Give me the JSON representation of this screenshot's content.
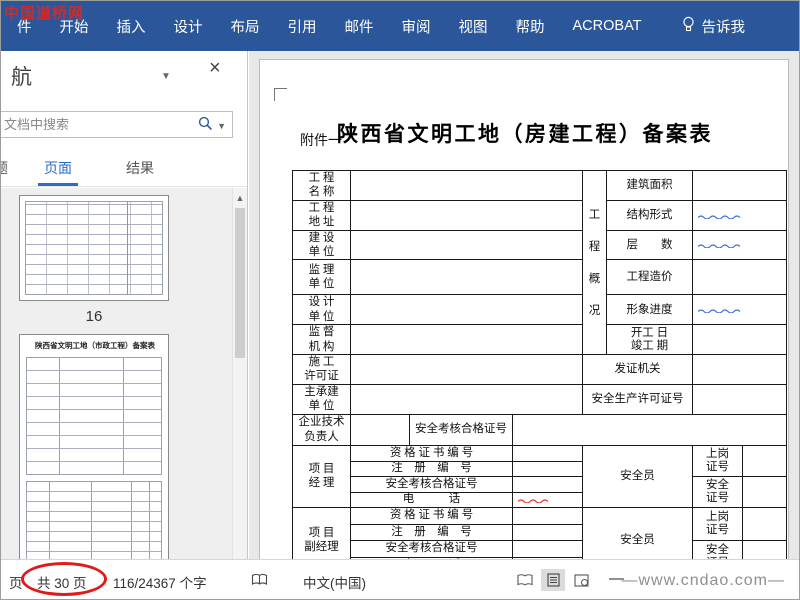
{
  "colors": {
    "ribbon": "#2b579a",
    "accent": "#2b6cc4",
    "annotation_red": "#e01b1b",
    "grammar_squiggle_blue": "#3b6fd4",
    "spelling_squiggle_red": "#e03131"
  },
  "icons": {
    "close": "×",
    "caret_down": "▼",
    "scroll_up": "▲",
    "minus": "—"
  },
  "watermarks": {
    "top_left": "中国道桥网",
    "bottom_right": "—www.cndao.com—"
  },
  "ribbon": {
    "tabs": [
      "件",
      "开始",
      "插入",
      "设计",
      "布局",
      "引用",
      "邮件",
      "审阅",
      "视图",
      "帮助",
      "ACROBAT"
    ],
    "tell_me": "告诉我"
  },
  "nav_pane": {
    "title": "航",
    "search_placeholder": "文档中搜索",
    "tabs": [
      "题",
      "页面",
      "结果"
    ],
    "active_tab": "页面",
    "thumbnail_page_number": "16",
    "thumbnail2_title": "陕西省文明工地（市政工程）备案表"
  },
  "document": {
    "attachment_label": "附件一",
    "title": "陕西省文明工地（房建工程）备案表",
    "table": {
      "left_rows": [
        "工 程\n名 称",
        "工 程\n地 址",
        "建 设\n单 位",
        "监 理\n单 位",
        "设 计\n单 位",
        "监 督\n机 构",
        "施 工\n许可证",
        "主承建\n单 位"
      ],
      "overview_title": "工\n程\n概\n况",
      "overview_items": [
        "建筑面积",
        "结构形式",
        "层　　数",
        "工程造价",
        "形象进度",
        "开工 日\n竣工 期"
      ],
      "issuing_authority": "发证机关",
      "production_license": "安全生产许可证号",
      "tech_leader": "企业技术\n负责人",
      "exam_cert_no": "安全考核合格证号",
      "project_manager": "项 目\n经 理",
      "deputy_manager": "项 目\n副经理",
      "sub_rows": [
        "资 格 证 书 编 号",
        "注　册　编　号",
        "安全考核合格证号",
        "电　　　话"
      ],
      "safety_officer": "安全员",
      "post_cert": "上岗\n证号",
      "safety_cert": "安全\n证号"
    }
  },
  "status_bar": {
    "page_fragment": "页",
    "total_pages": "共 30 页",
    "word_count": "116/24367 个字",
    "language": "中文(中国)"
  }
}
